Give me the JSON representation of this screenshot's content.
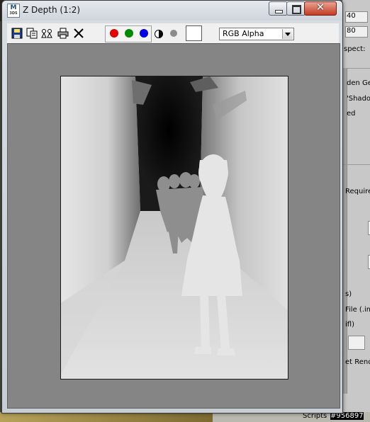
{
  "window": {
    "title": "Z Depth (1:2)",
    "app_icon_letter": "M",
    "app_icon_caption": "3DS"
  },
  "window_controls": {
    "minimize": "minimize",
    "maximize": "maximize",
    "close_glyph": "✕"
  },
  "toolbar": {
    "icons": [
      "save-icon",
      "copy-icon",
      "clone-window-icon",
      "print-icon",
      "clear-icon"
    ],
    "channels": [
      {
        "name": "red",
        "color": "#e00000"
      },
      {
        "name": "green",
        "color": "#008a00"
      },
      {
        "name": "blue",
        "color": "#0000e0"
      }
    ],
    "monochrome_icon": "monochrome-icon",
    "alpha_icon": "alpha-channel-icon",
    "swatch_color": "#ffffff",
    "channel_select": {
      "value": "RGB Alpha"
    }
  },
  "render": {
    "description_icon": "depth-render-image",
    "background_gray": "#858585"
  },
  "background_panel": {
    "fragments": [
      "40",
      "80",
      "spect:",
      "den Gec",
      "'Shadow",
      "ed",
      "Required",
      "s)",
      "File (.im",
      "ifl)",
      "et Rend"
    ],
    "scripts_label": "Scripts",
    "frame_number": "#956897"
  }
}
